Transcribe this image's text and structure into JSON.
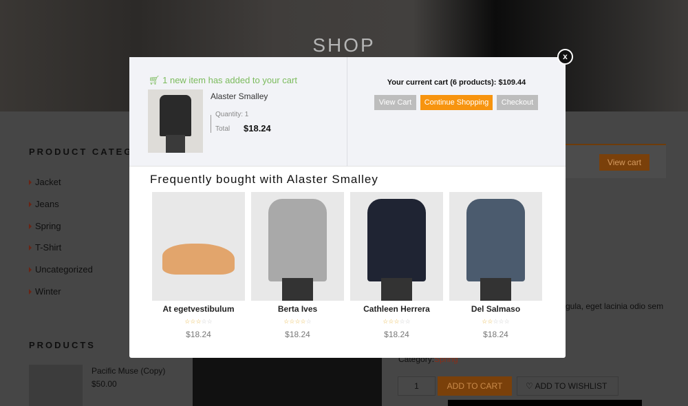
{
  "page": {
    "hero_title": "SHOP",
    "categories_heading": "PRODUCT CATEGORIES",
    "categories": [
      "Jacket",
      "Jeans",
      "Spring",
      "T-Shirt",
      "Uncategorized",
      "Winter"
    ],
    "products_heading": "PRODUCTS",
    "sidebar_product": {
      "name": "Pacific Muse (Copy)",
      "price": "$50.00"
    },
    "view_cart": "View cart",
    "description_fragment": "gula, eget lacinia odio sem",
    "category_label": "Category:",
    "category_value": "Spring",
    "qty": "1",
    "add_to_cart": "ADD TO CART",
    "add_to_wishlist": "ADD TO WISHLIST"
  },
  "modal": {
    "added_message": "1 new item has added to your cart",
    "item": {
      "name": "Alaster Smalley",
      "quantity": "Quantity: 1",
      "total_label": "Total",
      "total": "$18.24"
    },
    "cart_summary": "Your current cart (6 products): $109.44",
    "buttons": {
      "view_cart": "View Cart",
      "continue": "Continue Shopping",
      "checkout": "Checkout"
    },
    "close": "x",
    "fbt_title": "Frequently bought with Alaster Smalley",
    "products": [
      {
        "name": "At egetvestibulum",
        "rating": 3,
        "price": "$18.24"
      },
      {
        "name": "Berta Ives",
        "rating": 4,
        "price": "$18.24"
      },
      {
        "name": "Cathleen Herrera",
        "rating": 3,
        "price": "$18.24"
      },
      {
        "name": "Del Salmaso",
        "rating": 2,
        "price": "$18.24"
      }
    ]
  },
  "colors": {
    "accent": "#f7940f",
    "added_green": "#7bbb5c",
    "grey_button": "#bdbdbd",
    "star": "#e8b84a"
  }
}
